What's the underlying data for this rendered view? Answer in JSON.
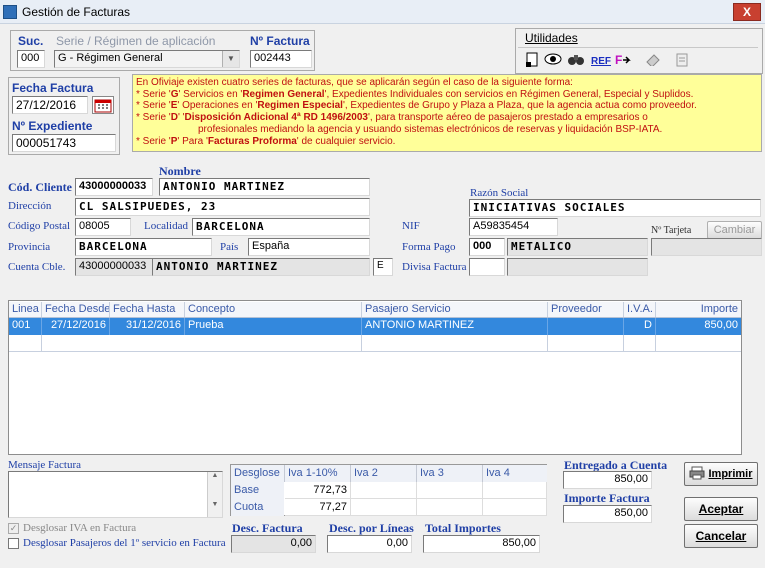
{
  "window": {
    "title": "Gestión de Facturas",
    "close": "X"
  },
  "serie": {
    "suc_label": "Suc.",
    "serie_label": "Serie / Régimen de aplicación",
    "nfactura_label": "Nº Factura",
    "suc_value": "000",
    "serie_value": "G - Régimen General",
    "nfactura_value": "002443"
  },
  "toolbar": {
    "utilidades": "Utilidades",
    "icons": [
      "document-icon",
      "eye-icon",
      "binoculars-icon",
      "ref-icon",
      "transfer-icon",
      "eraser-icon",
      "attach-icon"
    ],
    "ref_text": "REF"
  },
  "fecha": {
    "label": "Fecha Factura",
    "value": "27/12/2016"
  },
  "expediente": {
    "label": "Nº Expediente",
    "value": "000051743"
  },
  "note": {
    "line1": "En Ofiviaje existen cuatro series de facturas, que se aplicarán según el caso de la siguiente forma:",
    "l2a": "* Serie '",
    "l2b": "G",
    "l2c": "' Servicios en '",
    "l2d": "Regimen General",
    "l2e": "', Expedientes Individuales con servicios en Régimen General, Especial y Suplidos.",
    "l3a": "* Serie '",
    "l3b": "E",
    "l3c": "' Operaciones en '",
    "l3d": "Regimen Especial",
    "l3e": "', Expedientes de Grupo y Plaza a Plaza,  que la agencia actua como proveedor.",
    "l4a": "* Serie '",
    "l4b": "D",
    "l4c": "' '",
    "l4d": "Disposición Adicional 4ª RD 1496/2003",
    "l4e": "', para transporte aéreo de pasajeros prestado a empresarios o",
    "l5": "profesionales mediando la agencia y usuando sistemas electrónicos de reservas y liquidación BSP-IATA.",
    "l6a": "* Serie '",
    "l6b": "P",
    "l6c": "' Para '",
    "l6d": "Facturas Proforma",
    "l6e": "' de cualquier servicio."
  },
  "cliente": {
    "nombre_label": "Nombre",
    "cod_label": "Cód. Cliente",
    "cod_value": "43000000033",
    "nombre_value": "ANTONIO MARTINEZ",
    "razon_label": "Razón Social",
    "razon_value": "INICIATIVAS SOCIALES",
    "direccion_label": "Dirección",
    "direccion_value": "CL SALSIPUEDES, 23",
    "cp_label": "Código Postal",
    "cp_value": "08005",
    "localidad_label": "Localidad",
    "localidad_value": "BARCELONA",
    "nif_label": "NIF",
    "nif_value": "A59835454",
    "tarjeta_label": "Nº Tarjeta",
    "cambiar_label": "Cambiar",
    "provincia_label": "Provincia",
    "provincia_value": "BARCELONA",
    "pais_label": "País",
    "pais_value": "España",
    "forma_label": "Forma Pago",
    "forma_code": "000",
    "forma_value": "METALICO",
    "cuenta_label": "Cuenta Cble.",
    "cuenta_value": "43000000033",
    "cuenta_nombre": "ANTONIO MARTINEZ",
    "cuenta_flag": "E",
    "divisa_label": "Divisa Factura",
    "divisa_code": "",
    "divisa_value": ""
  },
  "grid": {
    "headers": [
      "Linea",
      "Fecha Desde",
      "Fecha Hasta",
      "Concepto",
      "Pasajero Servicio",
      "Proveedor",
      "I.V.A.",
      "Importe"
    ],
    "rows": [
      [
        "001",
        "27/12/2016",
        "31/12/2016",
        "Prueba",
        "ANTONIO MARTINEZ",
        "",
        "D",
        "850,00"
      ]
    ]
  },
  "mensaje": {
    "label": "Mensaje Factura",
    "value": ""
  },
  "desglose": {
    "headers": [
      "Desglose",
      "Iva 1-10%",
      "Iva 2",
      "Iva 3",
      "Iva 4"
    ],
    "base_label": "Base",
    "cuota_label": "Cuota",
    "base": [
      "772,73",
      "",
      "",
      ""
    ],
    "cuota": [
      "77,27",
      "",
      "",
      ""
    ]
  },
  "checks": {
    "iva_label": "Desglosar IVA en Factura",
    "iva_checked": true,
    "pasajeros_label": "Desglosar Pasajeros del 1º servicio en Factura",
    "pasajeros_checked": false
  },
  "totales": {
    "desc_factura_label": "Desc. Factura",
    "desc_factura_value": "0,00",
    "desc_lineas_label": "Desc. por Líneas",
    "desc_lineas_value": "0,00",
    "total_label": "Total Importes",
    "total_value": "850,00",
    "entregado_label": "Entregado a Cuenta",
    "entregado_value": "850,00",
    "importe_label": "Importe Factura",
    "importe_value": "850,00"
  },
  "buttons": {
    "imprimir": "Imprimir",
    "aceptar": "Aceptar",
    "cancelar": "Cancelar"
  }
}
